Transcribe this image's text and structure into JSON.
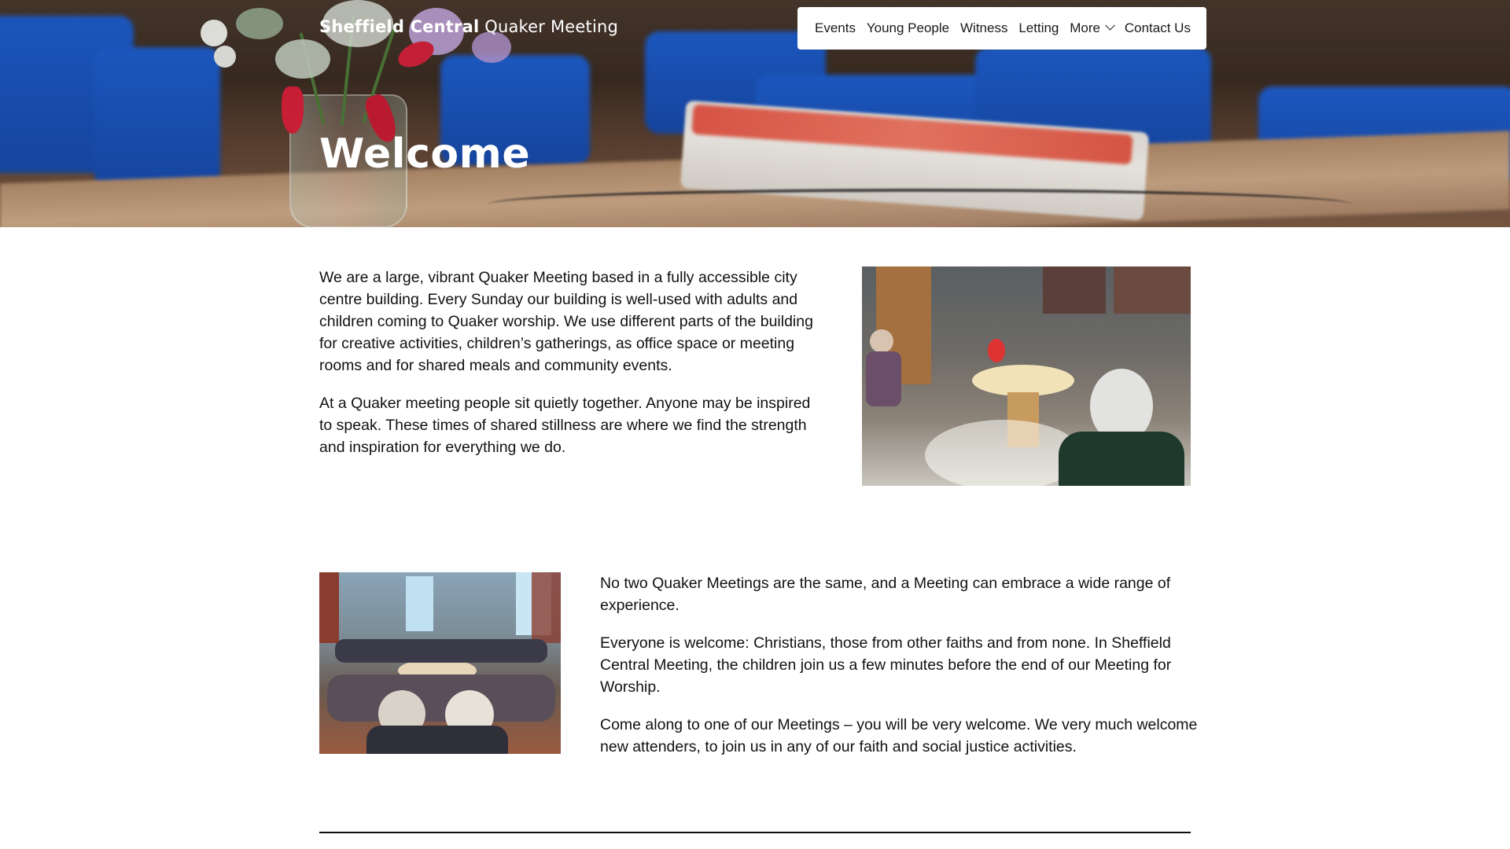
{
  "site": {
    "title_part1": "Sheffield Central",
    "title_part2": " Quaker Meeting"
  },
  "nav": {
    "items": [
      {
        "label": "Events"
      },
      {
        "label": "Young People"
      },
      {
        "label": "Witness"
      },
      {
        "label": "Letting"
      },
      {
        "label": "More"
      },
      {
        "label": "Contact Us"
      }
    ]
  },
  "hero": {
    "heading": "Welcome"
  },
  "intro": {
    "paragraphs": [
      "We are a large, vibrant Quaker Meeting based in a fully accessible city centre building. Every Sunday our building is well-used with adults and children coming to Quaker worship. We use different parts of the building for creative activities, children’s gatherings, as office space or meeting rooms and for shared meals and community events.",
      "At a Quaker meeting people sit quietly together. Anyone may be inspired to speak. These times of shared stillness are where we find the strength and inspiration for everything we do."
    ]
  },
  "welcome": {
    "paragraphs": [
      "No two Quaker Meetings are the same, and a Meeting can embrace a wide range of experience.",
      "Everyone is welcome: Christians, those from other faiths and from none. In Sheffield Central Meeting, the children join us a few minutes before the end of our Meeting for Worship.",
      "Come along to one of our Meetings – you will be very welcome. We very much welcome new attenders, to join us in any of our faith and social justice activities."
    ]
  },
  "icons": {
    "more_dropdown": "chevron-down-icon"
  },
  "colors": {
    "chair_blue": "#1f5fd0",
    "book_red": "#e85a4a",
    "divider": "#111111"
  }
}
